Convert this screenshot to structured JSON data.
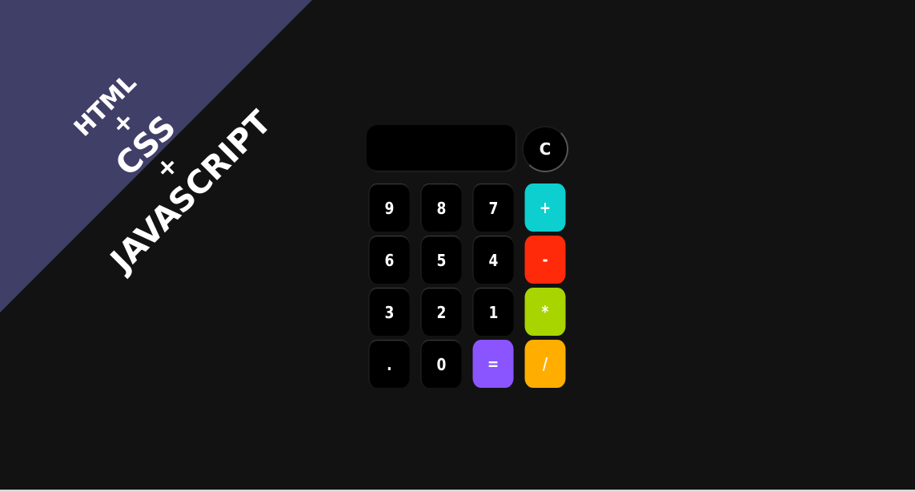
{
  "banner": {
    "lines": [
      "HTML",
      "+",
      "CSS",
      "+",
      "JAVASCRIPT"
    ],
    "background": "#3f3f68",
    "text_color": "#ffffff"
  },
  "calculator": {
    "display_value": "",
    "clear_label": "C",
    "keys": [
      {
        "label": "9",
        "kind": "digit",
        "color": "#000000"
      },
      {
        "label": "8",
        "kind": "digit",
        "color": "#000000"
      },
      {
        "label": "7",
        "kind": "digit",
        "color": "#000000"
      },
      {
        "label": "+",
        "kind": "operator",
        "color": "#0dcfcf"
      },
      {
        "label": "6",
        "kind": "digit",
        "color": "#000000"
      },
      {
        "label": "5",
        "kind": "digit",
        "color": "#000000"
      },
      {
        "label": "4",
        "kind": "digit",
        "color": "#000000"
      },
      {
        "label": "-",
        "kind": "operator",
        "color": "#ff2a0a"
      },
      {
        "label": "3",
        "kind": "digit",
        "color": "#000000"
      },
      {
        "label": "2",
        "kind": "digit",
        "color": "#000000"
      },
      {
        "label": "1",
        "kind": "digit",
        "color": "#000000"
      },
      {
        "label": "*",
        "kind": "operator",
        "color": "#a8d400"
      },
      {
        "label": ".",
        "kind": "digit",
        "color": "#000000"
      },
      {
        "label": "0",
        "kind": "digit",
        "color": "#000000"
      },
      {
        "label": "=",
        "kind": "equals",
        "color": "#8a55ff"
      },
      {
        "label": "/",
        "kind": "operator",
        "color": "#ffae00"
      }
    ]
  }
}
